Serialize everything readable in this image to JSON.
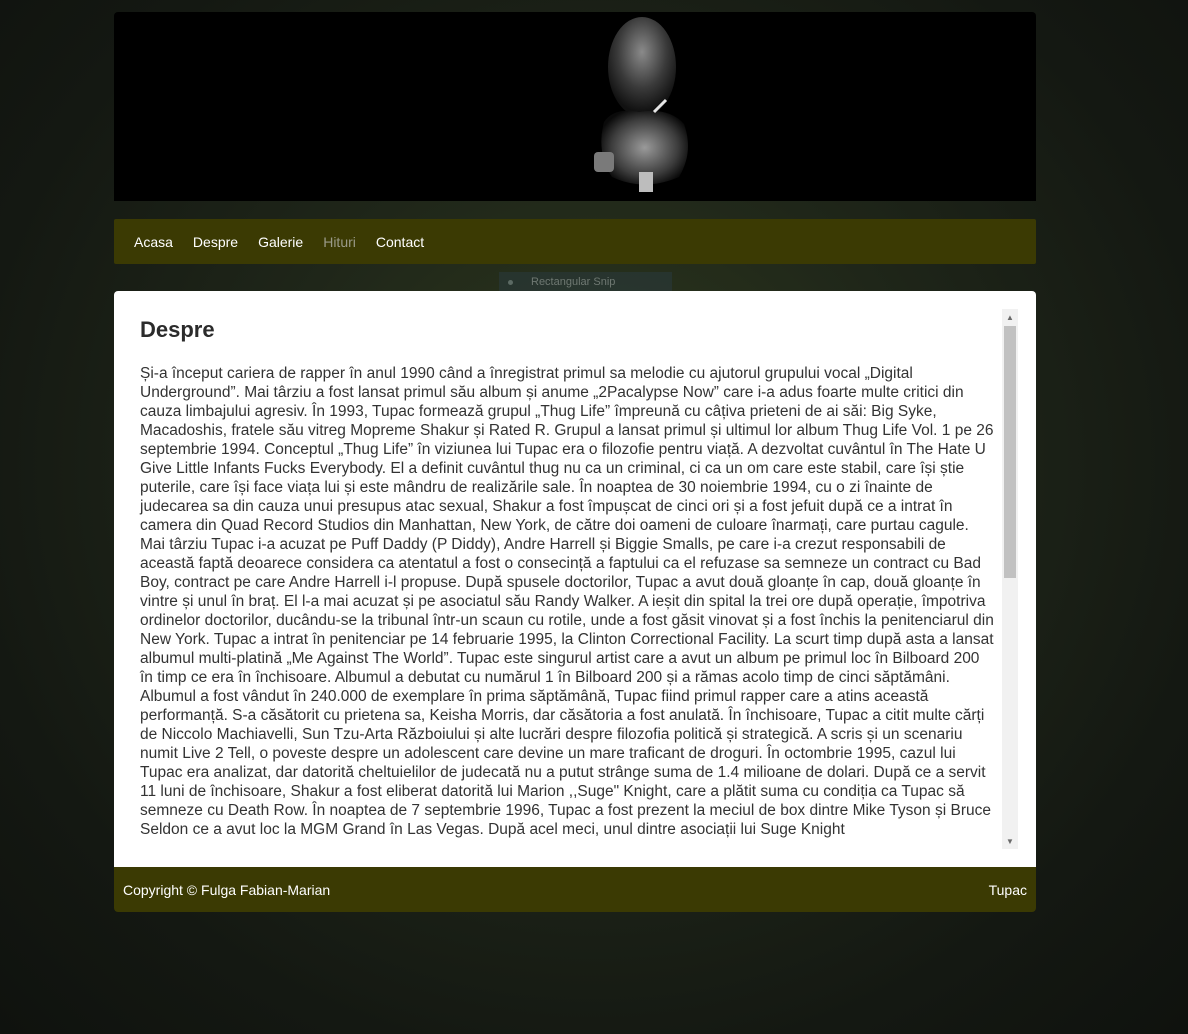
{
  "header": {
    "image_icon": "tupac-portrait-image"
  },
  "nav": {
    "items": [
      {
        "label": "Acasa"
      },
      {
        "label": "Despre"
      },
      {
        "label": "Galerie"
      },
      {
        "label": "Hituri"
      },
      {
        "label": "Contact"
      }
    ]
  },
  "overlay": {
    "snip_label": "Rectangular Snip"
  },
  "main": {
    "title": "Despre",
    "body": "Și-a început cariera de rapper în anul 1990 când a înregistrat primul sa melodie cu ajutorul grupului vocal „Digital Underground”. Mai târziu a fost lansat primul său album și anume „2Pacalypse Now” care i-a adus foarte multe critici din cauza limbajului agresiv. În 1993, Tupac formează grupul „Thug Life” împreună cu câțiva prieteni de ai săi: Big Syke, Macadoshis, fratele său vitreg Mopreme Shakur și Rated R. Grupul a lansat primul și ultimul lor album Thug Life Vol. 1 pe 26 septembrie 1994. Conceptul „Thug Life” în viziunea lui Tupac era o filozofie pentru viață. A dezvoltat cuvântul în The Hate U Give Little Infants Fucks Everybody. El a definit cuvântul thug nu ca un criminal, ci ca un om care este stabil, care își știe puterile, care își face viața lui și este mândru de realizările sale. În noaptea de 30 noiembrie 1994, cu o zi înainte de judecarea sa din cauza unui presupus atac sexual, Shakur a fost împușcat de cinci ori și a fost jefuit după ce a intrat în camera din Quad Record Studios din Manhattan, New York, de către doi oameni de culoare înarmați, care purtau cagule. Mai târziu Tupac i-a acuzat pe Puff Daddy (P Diddy), Andre Harrell și Biggie Smalls, pe care i-a crezut responsabili de această faptă deoarece considera ca atentatul a fost o consecință a faptului ca el refuzase sa semneze un contract cu Bad Boy, contract pe care Andre Harrell i-l propuse. După spusele doctorilor, Tupac a avut două gloanțe în cap, două gloanțe în vintre și unul în braț. El l-a mai acuzat și pe asociatul său Randy Walker. A ieșit din spital la trei ore după operație, împotriva ordinelor doctorilor, ducându-se la tribunal într-un scaun cu rotile, unde a fost găsit vinovat și a fost închis la penitenciarul din New York. Tupac a intrat în penitenciar pe 14 februarie 1995, la Clinton Correctional Facility. La scurt timp după asta a lansat albumul multi-platină „Me Against The World”. Tupac este singurul artist care a avut un album pe primul loc în Bilboard 200 în timp ce era în închisoare. Albumul a debutat cu numărul 1 în Bilboard 200 și a rămas acolo timp de cinci săptămâni. Albumul a fost vândut în 240.000 de exemplare în prima săptămână, Tupac fiind primul rapper care a atins această performanță. S-a căsătorit cu prietena sa, Keisha Morris, dar căsătoria a fost anulată. În închisoare, Tupac a citit multe cărți de Niccolo Machiavelli, Sun Tzu-Arta Războiului și alte lucrări despre filozofia politică și strategică. A scris și un scenariu numit Live 2 Tell, o poveste despre un adolescent care devine un mare traficant de droguri. În octombrie 1995, cazul lui Tupac era analizat, dar datorită cheltuielilor de judecată nu a putut strânge suma de 1.4 milioane de dolari. După ce a servit 11 luni de închisoare, Shakur a fost eliberat datorită lui Marion ,,Suge\" Knight, care a plătit suma cu condiția ca Tupac să semneze cu Death Row. În noaptea de 7 septembrie 1996, Tupac a fost prezent la meciul de box dintre Mike Tyson și Bruce Seldon ce a avut loc la MGM Grand în Las Vegas. După acel meci, unul dintre asociații lui Suge Knight"
  },
  "footer": {
    "copyright": "Copyright © Fulga Fabian-Marian",
    "brand": "Tupac"
  },
  "colors": {
    "nav_bg": "#3b3a03",
    "active_nav": "#9a9a88"
  }
}
